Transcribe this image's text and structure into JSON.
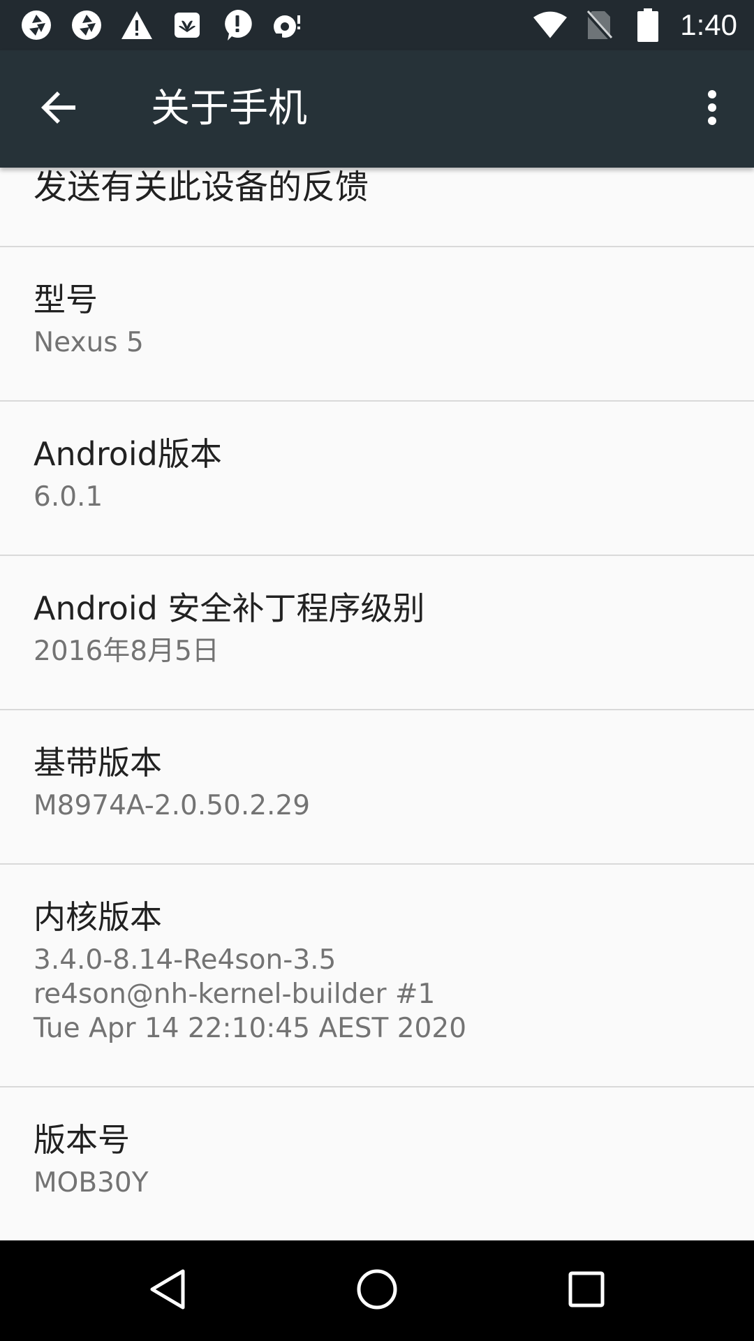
{
  "status_bar": {
    "time": "1:40",
    "left_icons": [
      "shutter-icon",
      "shutter-icon",
      "warning-icon",
      "huawei-icon",
      "alert-bubble-icon",
      "sync-icon"
    ],
    "right_icons": [
      "wifi-icon",
      "no-sim-icon",
      "battery-icon"
    ]
  },
  "toolbar": {
    "title": "关于手机",
    "back_icon": "arrow-back-icon",
    "menu_icon": "more-vert-icon"
  },
  "list": {
    "partial_item": {
      "title": "发送有关此设备的反馈"
    },
    "items": [
      {
        "title": "型号",
        "value": "Nexus 5"
      },
      {
        "title": "Android版本",
        "value": "6.0.1"
      },
      {
        "title": "Android 安全补丁程序级别",
        "value": "2016年8月5日"
      },
      {
        "title": "基带版本",
        "value": "M8974A-2.0.50.2.29"
      },
      {
        "title": "内核版本",
        "value": "3.4.0-8.14-Re4son-3.5\nre4son@nh-kernel-builder #1\nTue Apr 14 22:10:45 AEST 2020"
      },
      {
        "title": "版本号",
        "value": "MOB30Y"
      }
    ]
  },
  "nav_bar": {
    "buttons": [
      "back-triangle-icon",
      "home-circle-icon",
      "recents-square-icon"
    ]
  },
  "colors": {
    "status_bar": "#222a30",
    "toolbar": "#263238",
    "background": "#fafafa",
    "title_text": "#212121",
    "value_text": "#737373",
    "divider": "#d9d9d9"
  }
}
